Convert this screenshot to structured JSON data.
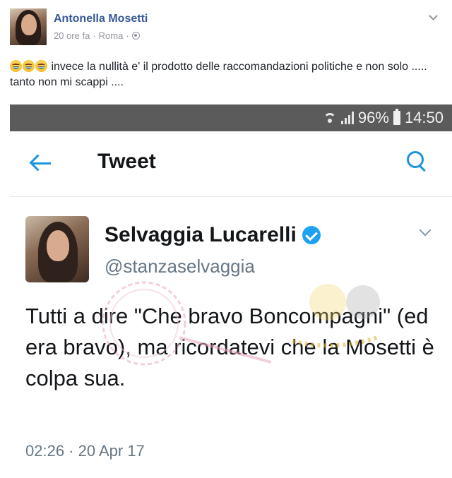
{
  "fb_post": {
    "author": "Antonella Mosetti",
    "time": "20 ore fa",
    "separator": "·",
    "location": "Roma",
    "text": "invece la nullità e' il prodotto delle raccomandazioni politiche e non solo ..... tanto non mi scappi ....",
    "emojis": [
      "tears-of-joy-emoji",
      "tears-of-joy-emoji",
      "tears-of-joy-emoji"
    ]
  },
  "status_bar": {
    "battery": "96%",
    "clock": "14:50"
  },
  "tweet_screen": {
    "title": "Tweet",
    "author_name": "Selvaggia Lucarelli",
    "handle": "@stanzaselvaggia",
    "text": "Tutti a dire \"Che bravo Boncompagni\" (ed era bravo), ma ricordatevi che la Mosetti è colpa sua.",
    "timestamp": "02:26 · 20 Apr 17"
  },
  "colors": {
    "fb_link": "#365899",
    "twitter_blue": "#1b95e0",
    "status_bar_bg": "#5b5b5b",
    "muted": "#657786"
  }
}
